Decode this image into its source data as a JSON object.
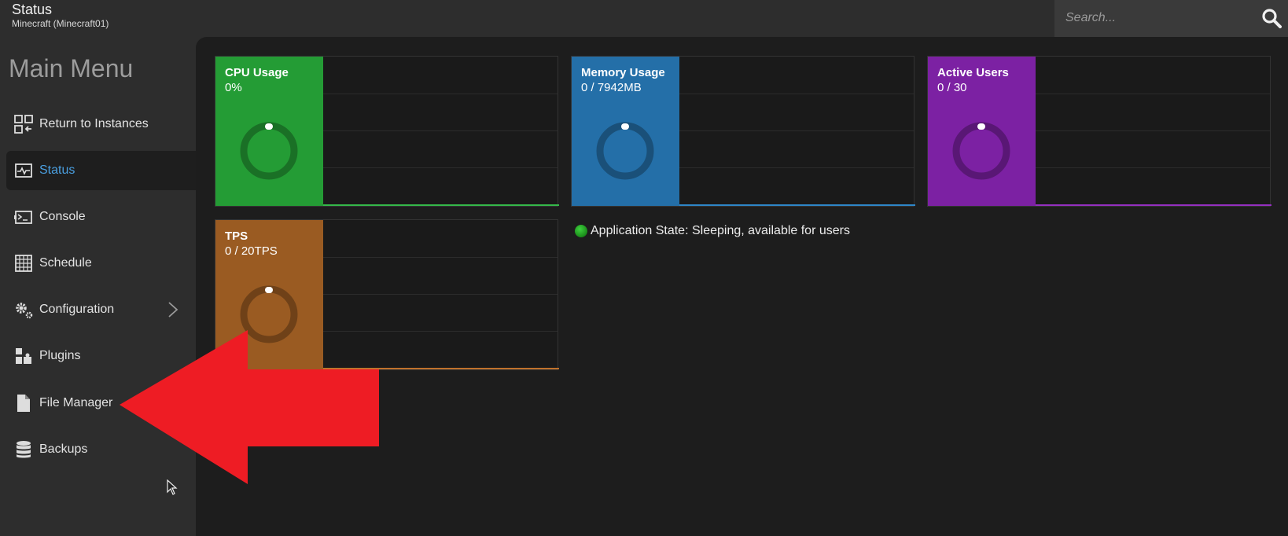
{
  "header": {
    "title": "Status",
    "subtitle": "Minecraft (Minecraft01)",
    "search_placeholder": "Search..."
  },
  "sidebar": {
    "menu_title": "Main Menu",
    "items": [
      {
        "label": "Return to Instances",
        "icon": "return-instances-icon"
      },
      {
        "label": "Status",
        "icon": "status-icon",
        "active": true
      },
      {
        "label": "Console",
        "icon": "console-icon"
      },
      {
        "label": "Schedule",
        "icon": "schedule-icon"
      },
      {
        "label": "Configuration",
        "icon": "gear-icon",
        "has_submenu": true
      },
      {
        "label": "Plugins",
        "icon": "plugins-icon"
      },
      {
        "label": "File Manager",
        "icon": "file-icon"
      },
      {
        "label": "Backups",
        "icon": "database-icon"
      }
    ]
  },
  "cards": [
    {
      "label": "CPU Usage",
      "value": "0%",
      "color": "#249c35",
      "accent": "#35b84a"
    },
    {
      "label": "Memory Usage",
      "value": "0 / 7942MB",
      "color": "#246fa8",
      "accent": "#2e86c8"
    },
    {
      "label": "Active Users",
      "value": "0 / 30",
      "color": "#7c21a3",
      "accent": "#9530c0"
    },
    {
      "label": "TPS",
      "value": "0 / 20TPS",
      "color": "#9a5b22",
      "accent": "#c0722c"
    }
  ],
  "app_state": {
    "text": "Application State: Sleeping, available for users",
    "status_color": "#1fae1f"
  },
  "annotation": {
    "arrow_color": "#ee1c24",
    "points_to": "File Manager"
  }
}
